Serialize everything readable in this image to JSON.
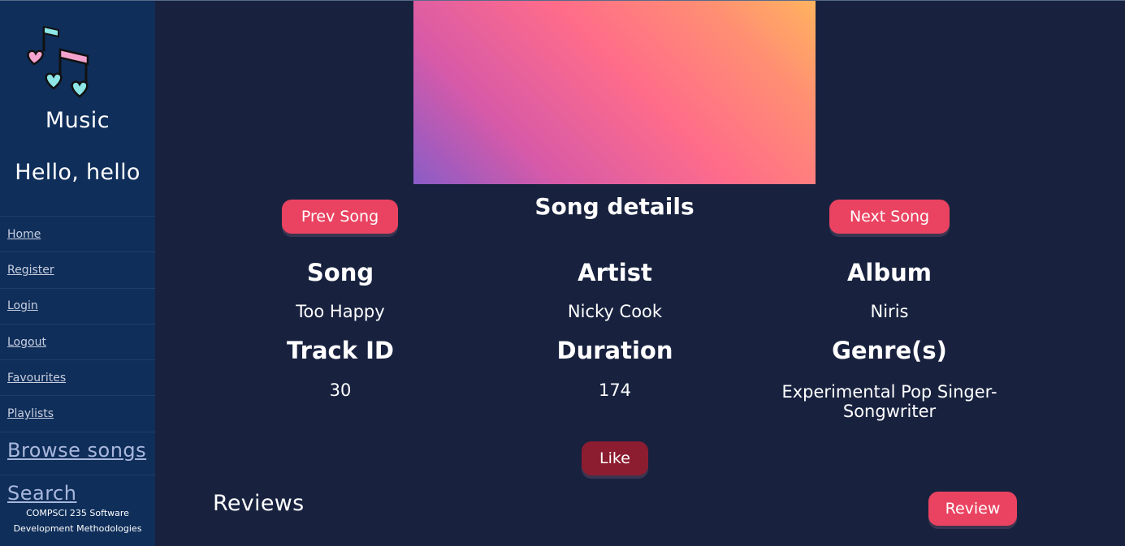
{
  "sidebar": {
    "brand": "Music",
    "greeting": "Hello, hello",
    "nav": [
      {
        "label": "Home"
      },
      {
        "label": "Register"
      },
      {
        "label": "Login"
      },
      {
        "label": "Logout"
      },
      {
        "label": "Favourites"
      },
      {
        "label": "Playlists"
      }
    ],
    "browse": "Browse songs",
    "search": "Search",
    "footer_line1": "COMPSCI 235 Software",
    "footer_line2": "Development Methodologies"
  },
  "main": {
    "heading": "Song details",
    "prev_button": "Prev Song",
    "next_button": "Next Song",
    "details": {
      "song_label": "Song",
      "song_value": "Too Happy",
      "artist_label": "Artist",
      "artist_value": "Nicky Cook",
      "album_label": "Album",
      "album_value": "Niris",
      "track_label": "Track ID",
      "track_value": "30",
      "duration_label": "Duration",
      "duration_value": "174",
      "genre_label": "Genre(s)",
      "genre_value": "Experimental Pop Singer-Songwriter"
    },
    "like_button": "Like",
    "reviews_heading": "Reviews",
    "review_button": "Review"
  },
  "colors": {
    "background": "#18223f",
    "sidebar": "#0f2e5a",
    "accent": "#ea4361",
    "like": "#8c1d30"
  }
}
